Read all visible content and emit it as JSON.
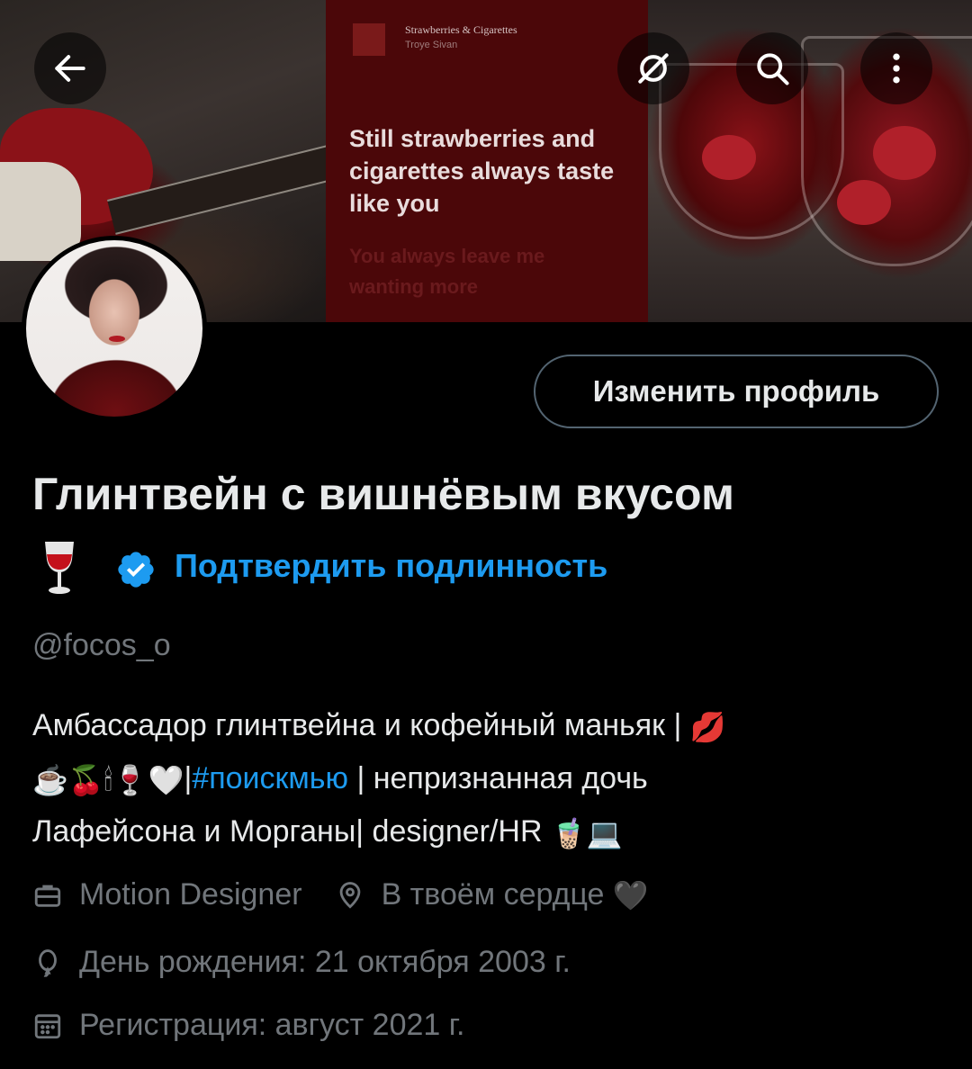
{
  "banner": {
    "song_title": "Strawberries & Cigarettes",
    "song_artist": "Troye Sivan",
    "lyric_line": "Still strawberries and cigarettes always taste like you",
    "lyric_dim": "You always leave me wanting more"
  },
  "top_bar": {
    "back_icon": "arrow-left-icon",
    "circle_icon": "circle-slash-icon",
    "search_icon": "search-icon",
    "more_icon": "more-vertical-icon"
  },
  "profile": {
    "edit_button": "Изменить профиль",
    "display_name": "Глинтвейн с вишнёвым вкусом",
    "name_emoji": "🍷",
    "verify_label": "Подтвердить подлинность",
    "handle": "@focos_o"
  },
  "bio": {
    "line1": "Амбассадор глинтвейна и кофейный маньяк | ",
    "emoji_kiss": "💋",
    "emoji_row": "☕🍒🕯🍷🤍",
    "pipe": "|",
    "hashtag": "#поискмью",
    "line2_rest": " | непризнанная дочь",
    "line3": "Лафейсона и Морганы| designer/HR ",
    "emoji_end": "🧋💻"
  },
  "meta": {
    "profession": "Motion Designer",
    "location": "В твоём сердце",
    "location_emoji": "🖤",
    "birthday": "День рождения: 21 октября 2003 г.",
    "joined": "Регистрация: август 2021 г."
  },
  "colors": {
    "accent": "#1d9bf0",
    "muted": "#71767b",
    "text": "#e7e9ea",
    "background": "#000000"
  }
}
